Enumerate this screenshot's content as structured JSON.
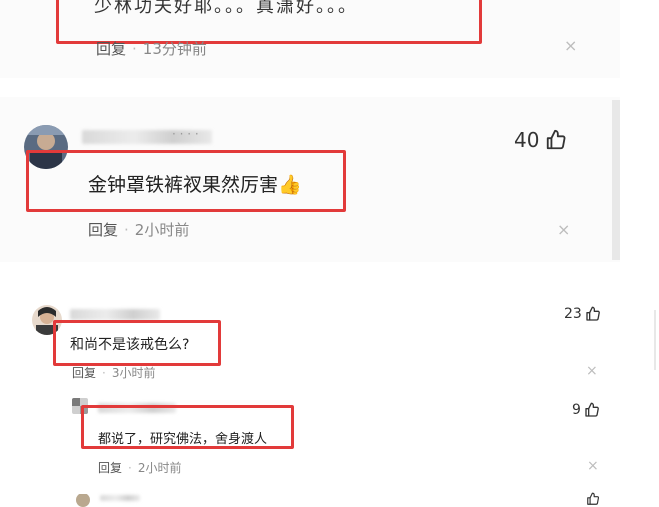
{
  "comments": [
    {
      "text": "少林功夫好耶。。。真潇好。。。",
      "reply_label": "回复",
      "time": "13分钟前",
      "likes": null
    },
    {
      "text": "金钟罩铁裤衩果然厉害",
      "emoji": "👍",
      "reply_label": "回复",
      "time": "2小时前",
      "likes": "40",
      "name_suffix": "· · · ·"
    },
    {
      "text": "和尚不是该戒色么?",
      "reply_label": "回复",
      "time": "3小时前",
      "likes": "23"
    },
    {
      "text": "都说了，研究佛法，舍身渡人",
      "reply_label": "回复",
      "time": "2小时前",
      "likes": "9"
    }
  ],
  "separator": "·",
  "close_glyph": "×",
  "colors": {
    "highlight_box": "#e23a3a",
    "panel_bg": "#fbfbfb",
    "meta_text": "#888888"
  }
}
